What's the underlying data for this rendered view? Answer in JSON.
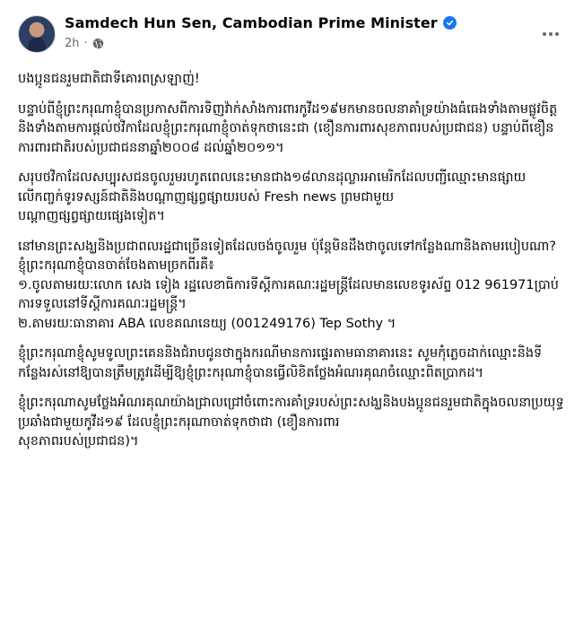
{
  "post": {
    "author": "Samdech Hun Sen, Cambodian Prime Minister",
    "time": "2h",
    "separator": "·",
    "icons": {
      "verified": "verified-badge-icon",
      "audience": "globe-icon",
      "menu": "more-options-icon"
    },
    "paragraphs": [
      "បងប្អូនជនរួមជាតិជាទីគោរពស្រឡាញ់!",
      "បន្ទាប់ពីខ្ញុំព្រះករុណាខ្ញុំបានប្រកាសពីការទិញវ៉ាក់សាំងការពារកូវីដ១៩មកមានចលនាគាំទ្រយ៉ាងធំធេងទាំងតាមផ្លូវចិត្តនិងទាំងតាមការផ្តល់ថវិកាដែលខ្ញុំព្រះករុណាខ្ញុំចាត់ទុកថានេះជា (ខឿនការពារសុខភាពរបស់ប្រជាជន) បន្ទាប់ពីខឿនការពារជាតិរបស់ប្រជាជននាឆ្នាំ២០០៨ ដល់ឆ្នាំ២០១១។",
      "សរុបថវិកាដែលសប្បុរសជនចូលរួមរហូតពេលនេះមានជាង១៨លានដុល្លារអាមេរិកដែលបញ្ជីឈ្មោះមានផ្សាយលើកញ្ចក់ទូរទស្សន៍ជាតិនិងបណ្តាញផ្សព្វផ្សាយរបស់ Fresh news ព្រមជាមួយ\nបណ្តាញផ្សព្វផ្សាយផ្សេងទៀត។",
      "នៅមានព្រះសង្ឃនិងប្រជាពលរដ្ឋជាច្រើនទៀតដែលចង់ចូលរួម ប៉ុន្តែមិនដឹងថាចូលទៅកន្លែងណានិងតាមរបៀបណា? ខ្ញុំព្រះករុណាខ្ញុំបានចាត់ចែងតាមច្រកពីរគឺ៖\n១.ចូលតាមរយៈលោក សេង ទៀង រដ្ឋលេខាធិការទីស្តីការគណៈរដ្ឋមន្ត្រីដែលមានលេខទូរស័ព្ទ 012 961971ប្រាប់ការទទួលនៅទីស្តីការគណៈរដ្ឋមន្ត្រី។\n២.តាមរយៈធានាគារ ABA លេខគណនេយ្យ (001249176) Tep Sothy ។",
      "ខ្ញុំព្រះករុណាខ្ញុំសូមទូលព្រះគេននិងជំរាបជូនថាក្នុងករណីមានការផ្ទេរតាមធានាគារនេះ សូមកុំភ្លេចដាក់ឈ្មោះនិងទីកន្លែងរស់នៅឱ្យបានត្រឹមត្រូវដើម្បីឱ្យខ្ញុំព្រះករុណាខ្ញុំបានធ្វើលិខិតថ្លែងអំណរគុណចំឈ្មោះពិតប្រាកដ។",
      "ខ្ញុំព្រះករុណាសូមថ្លែងអំណរគុណយ៉ាងជ្រាលជ្រៅចំពោះការគាំទ្ររបស់ព្រះសង្ឃនិងបងប្អូនជនរួមជាតិក្នុងចលនាប្រយុទ្ធប្រឆាំងជាមួយកូវីដ១៩ ដែលខ្ញុំព្រះករុណាចាត់ទុកថាជា (ខឿនការពារ\nសុខភាពរបស់ប្រជាជន)។"
    ]
  }
}
